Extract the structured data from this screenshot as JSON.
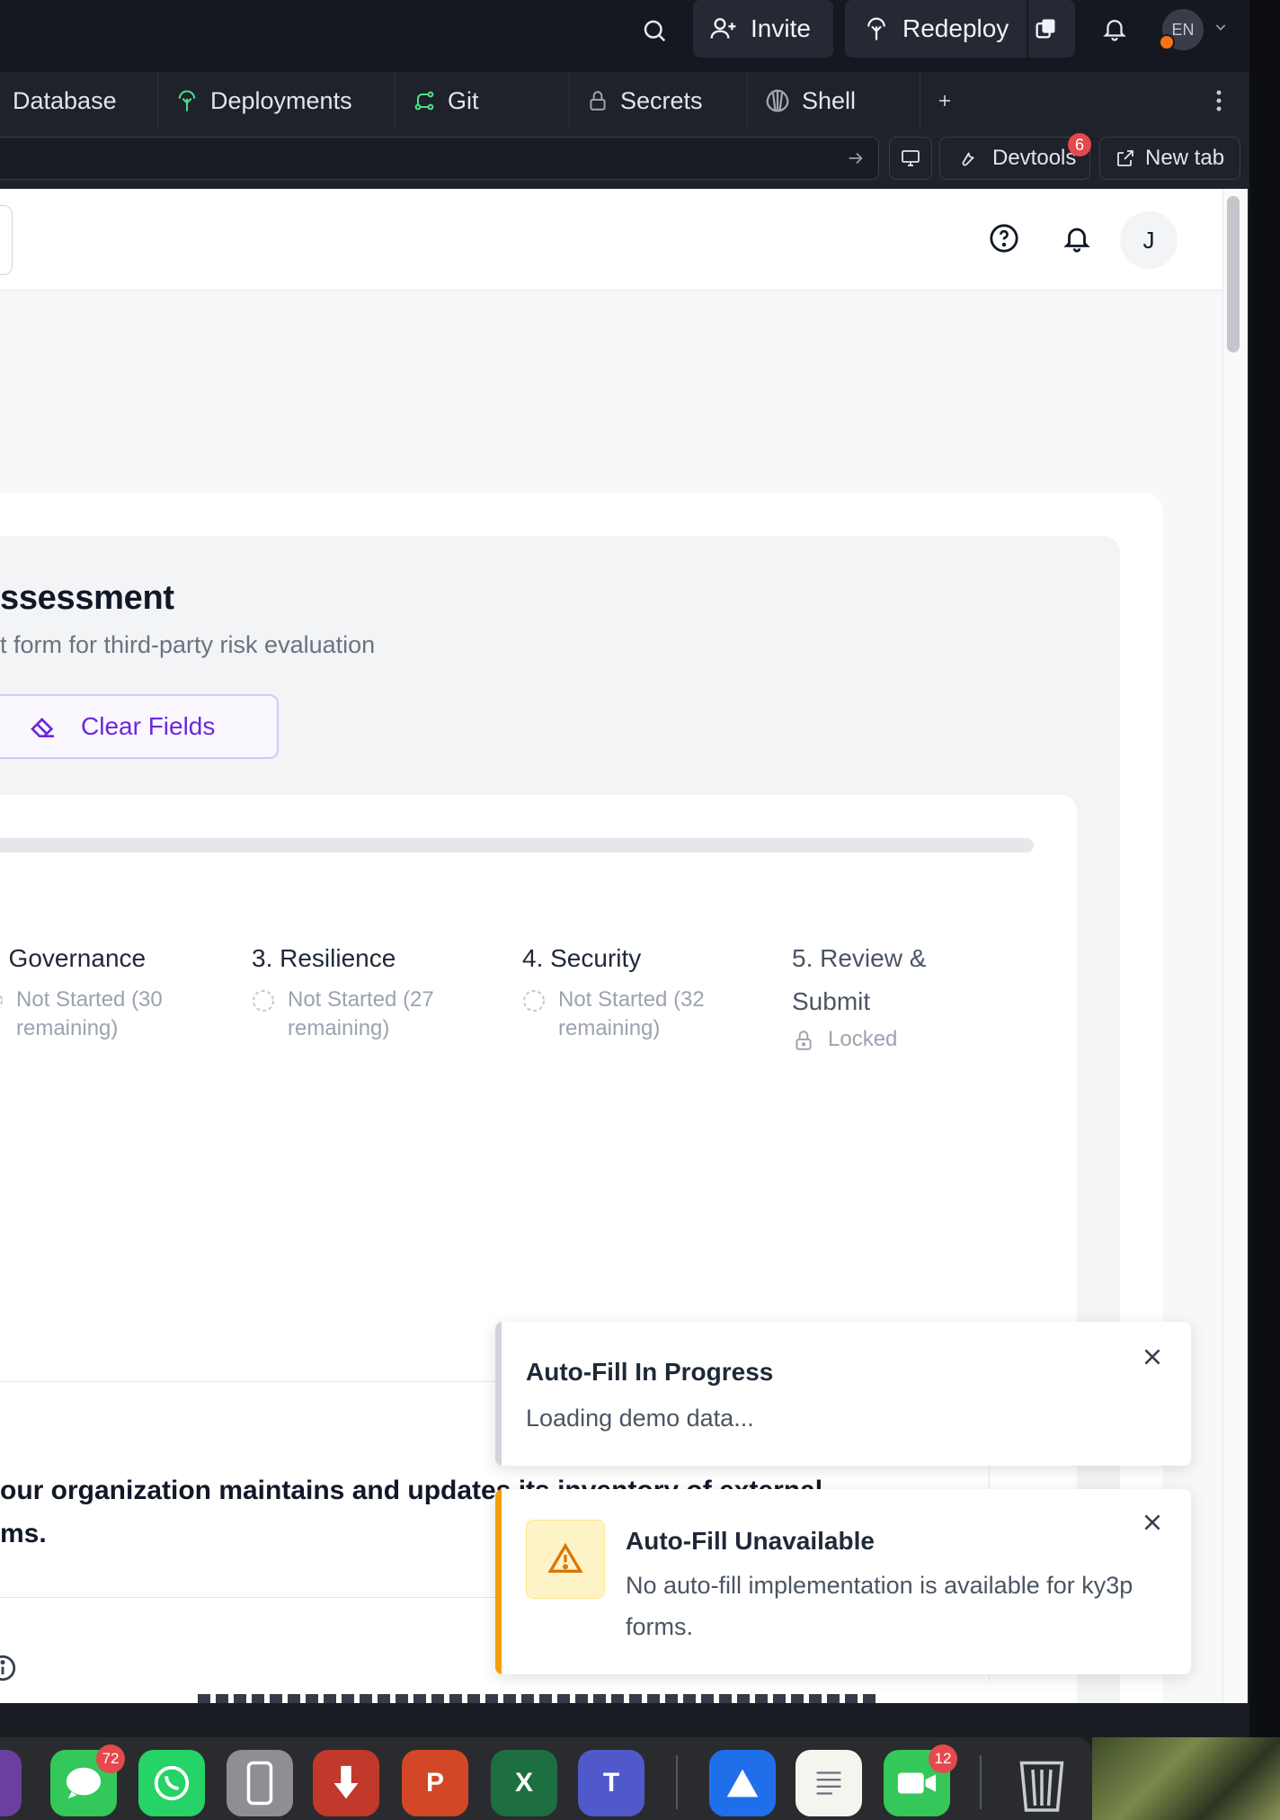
{
  "topbar": {
    "invite_label": "Invite",
    "redeploy_label": "Redeploy",
    "language": "EN"
  },
  "tabs": [
    {
      "label": "Database",
      "icon": "database-icon"
    },
    {
      "label": "Deployments",
      "icon": "deployments-icon"
    },
    {
      "label": "Git",
      "icon": "git-icon"
    },
    {
      "label": "Secrets",
      "icon": "lock-icon"
    },
    {
      "label": "Shell",
      "icon": "shell-icon"
    }
  ],
  "urlbar": {
    "devtools_label": "Devtools",
    "devtools_badge": "6",
    "new_tab_label": "New tab"
  },
  "app_header": {
    "avatar_initial": "J"
  },
  "form": {
    "title": "ssessment",
    "subtitle": "t form for third-party risk evaluation",
    "clear_label": "Clear Fields",
    "progress": 0
  },
  "steps": [
    {
      "title": ". Governance",
      "status": "Not Started (30 remaining)",
      "state": "not-started"
    },
    {
      "title": "3. Resilience",
      "status": "Not Started (27 remaining)",
      "state": "not-started"
    },
    {
      "title": "4. Security",
      "status": "Not Started (32 remaining)",
      "state": "not-started"
    },
    {
      "title": "5. Review & Submit",
      "status": "Locked",
      "state": "locked"
    }
  ],
  "question": {
    "text": "our organization maintains and updates its inventory of external ms."
  },
  "toasts": [
    {
      "title": "Auto-Fill In Progress",
      "message": "Loading demo data...",
      "accent": "#d1d5db"
    },
    {
      "title": "Auto-Fill Unavailable",
      "message": "No auto-fill implementation is available for ky3p forms.",
      "accent": "#f59e0b"
    }
  ],
  "dock": {
    "messages_badge": "72",
    "facetime_badge": "12"
  },
  "colors": {
    "accent": "#6d28d9",
    "warning": "#f59e0b"
  }
}
